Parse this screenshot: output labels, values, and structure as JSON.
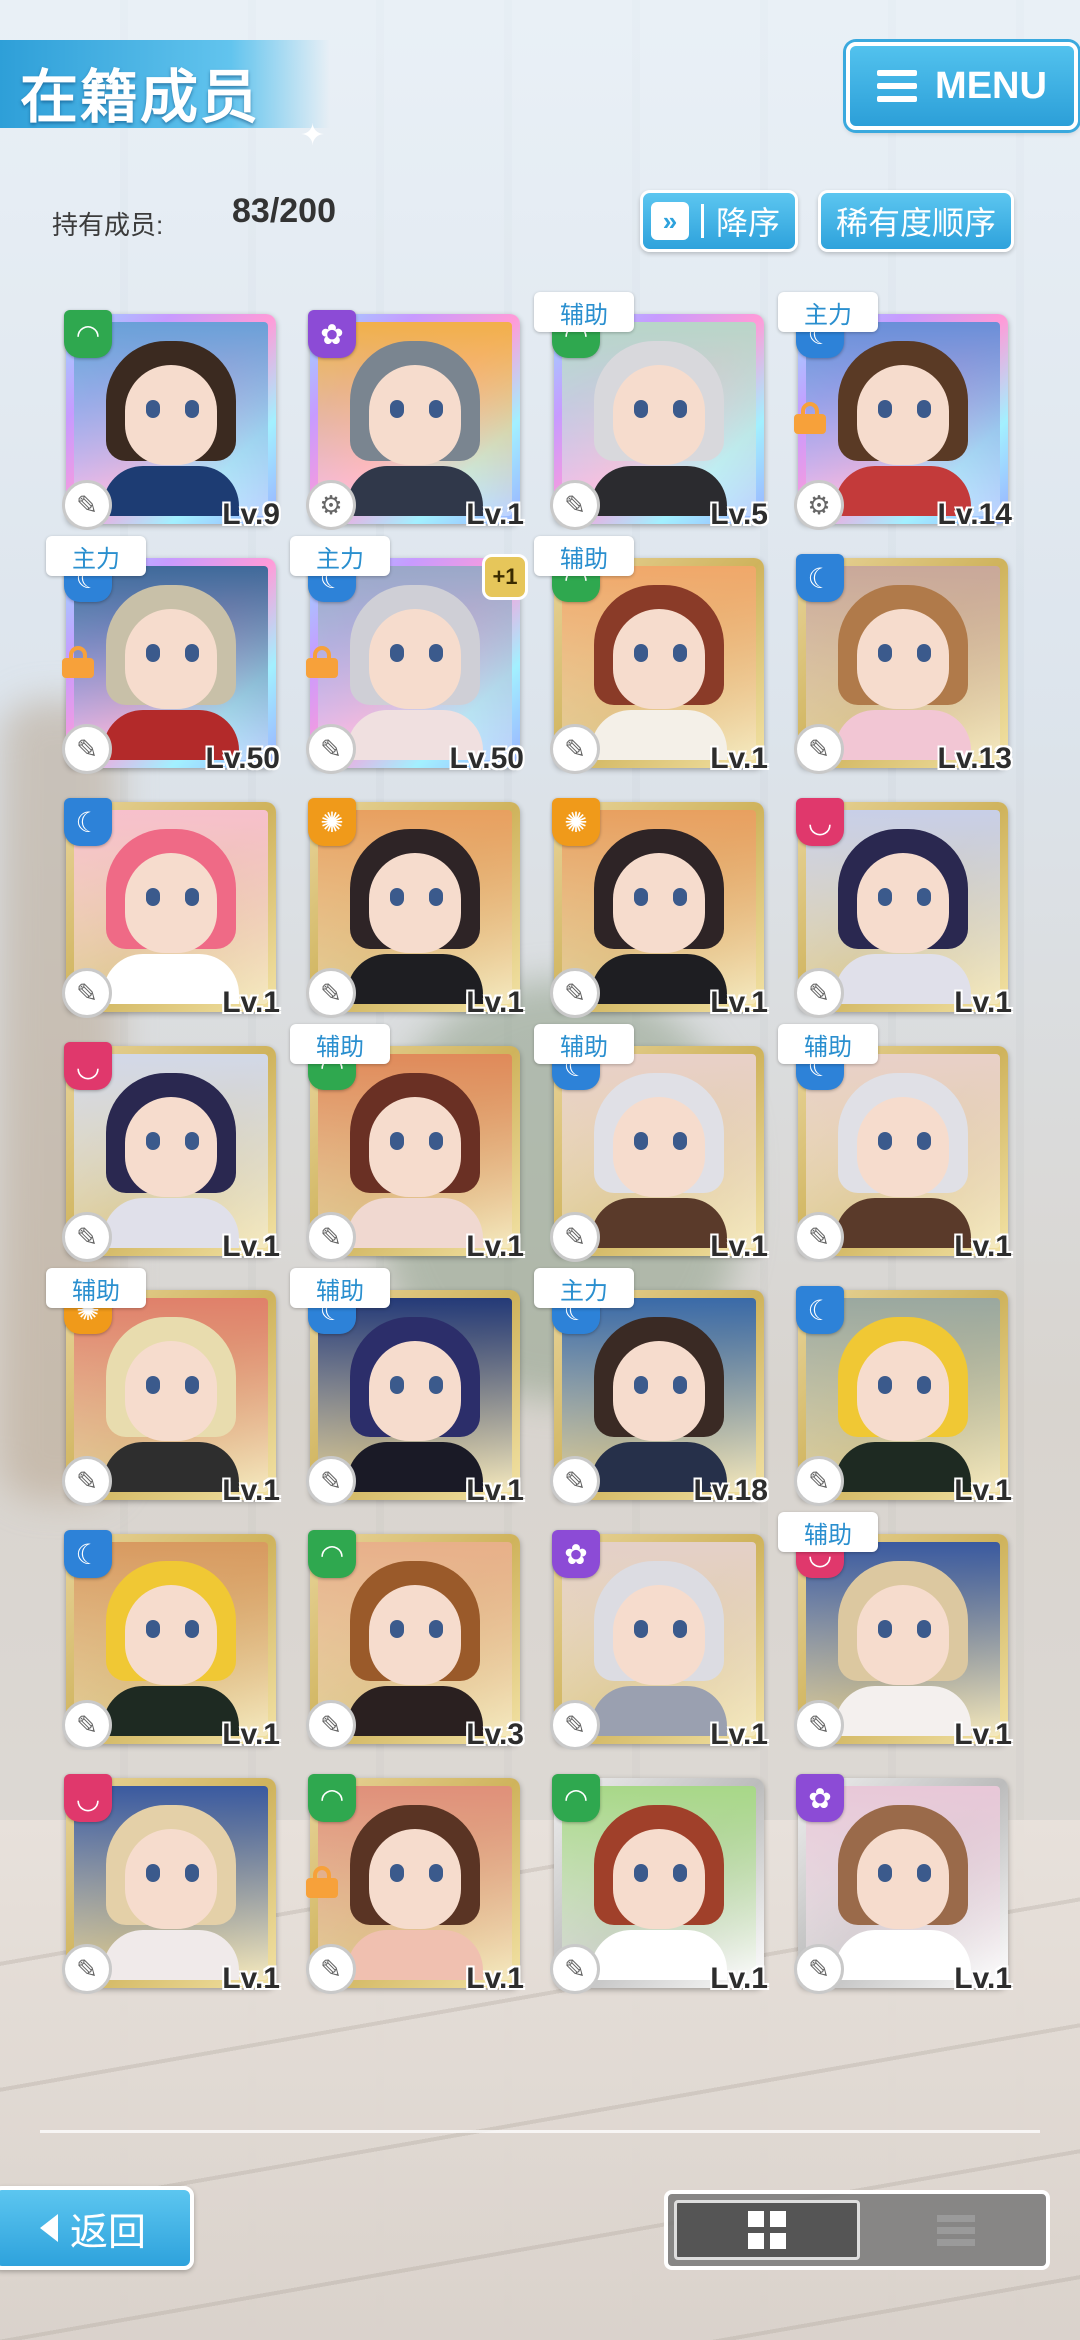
{
  "header": {
    "title": "在籍成员",
    "menu_label": "MENU"
  },
  "owned": {
    "label": "持有成员:",
    "value": "83/200"
  },
  "sort": {
    "order_label": "降序",
    "order_icon": "»",
    "rarity_label": "稀有度顺序"
  },
  "colors": {
    "accent": "#2ea2dc",
    "tag_text": "#2a8fcf",
    "lock": "#f7a13a"
  },
  "cards": [
    {
      "rarity": "rainbow",
      "attr": "green",
      "attr_icon": "◠",
      "role_icon": "✎",
      "level": "Lv.9",
      "tag": "",
      "lock": false,
      "plus": "",
      "hair": "#3b2a20",
      "bg": "#6aa0d8",
      "outfit": "#1d3c73"
    },
    {
      "rarity": "rainbow",
      "attr": "purple",
      "attr_icon": "✿",
      "role_icon": "⚙",
      "level": "Lv.1",
      "tag": "",
      "lock": false,
      "plus": "",
      "hair": "#7a8590",
      "bg": "#f2b04a",
      "outfit": "#30384a"
    },
    {
      "rarity": "rainbow",
      "attr": "green",
      "attr_icon": "◠",
      "role_icon": "✎",
      "level": "Lv.5",
      "tag": "辅助",
      "lock": false,
      "plus": "",
      "hair": "#d8d8dc",
      "bg": "#b8d6c8",
      "outfit": "#2b2b2f"
    },
    {
      "rarity": "rainbow",
      "attr": "blue",
      "attr_icon": "☾",
      "role_icon": "⚙",
      "level": "Lv.14",
      "tag": "主力",
      "lock": true,
      "plus": "",
      "hair": "#5a3a25",
      "bg": "#6a8fd8",
      "outfit": "#c33a3a"
    },
    {
      "rarity": "rainbow",
      "attr": "blue",
      "attr_icon": "☾",
      "role_icon": "✎",
      "level": "Lv.50",
      "tag": "主力",
      "lock": true,
      "plus": "",
      "hair": "#c8c0a8",
      "bg": "#3f6a9a",
      "outfit": "#b32a2a"
    },
    {
      "rarity": "rainbow",
      "attr": "blue",
      "attr_icon": "☾",
      "role_icon": "✎",
      "level": "Lv.50",
      "tag": "主力",
      "lock": true,
      "plus": "+1",
      "hair": "#cfcfd6",
      "bg": "#9aa8c8",
      "outfit": "#f0e0e0"
    },
    {
      "rarity": "gold",
      "attr": "green",
      "attr_icon": "◠",
      "role_icon": "✎",
      "level": "Lv.1",
      "tag": "辅助",
      "lock": false,
      "plus": "",
      "hair": "#8a3b28",
      "bg": "#f0a86a",
      "outfit": "#f4f0e8"
    },
    {
      "rarity": "gold",
      "attr": "blue",
      "attr_icon": "☾",
      "role_icon": "✎",
      "level": "Lv.13",
      "tag": "",
      "lock": false,
      "plus": "",
      "hair": "#b07a4a",
      "bg": "#c9a89a",
      "outfit": "#f2c6d4"
    },
    {
      "rarity": "gold",
      "attr": "blue",
      "attr_icon": "☾",
      "role_icon": "✎",
      "level": "Lv.1",
      "tag": "",
      "lock": false,
      "plus": "",
      "hair": "#ef6a86",
      "bg": "#f7c0cc",
      "outfit": "#ffffff"
    },
    {
      "rarity": "gold",
      "attr": "orange",
      "attr_icon": "✺",
      "role_icon": "✎",
      "level": "Lv.1",
      "tag": "",
      "lock": false,
      "plus": "",
      "hair": "#2e2426",
      "bg": "#e8a060",
      "outfit": "#1e1e22"
    },
    {
      "rarity": "gold",
      "attr": "orange",
      "attr_icon": "✺",
      "role_icon": "✎",
      "level": "Lv.1",
      "tag": "",
      "lock": false,
      "plus": "",
      "hair": "#2e2426",
      "bg": "#e8a060",
      "outfit": "#1e1e22"
    },
    {
      "rarity": "gold",
      "attr": "pink",
      "attr_icon": "◡",
      "role_icon": "✎",
      "level": "Lv.1",
      "tag": "",
      "lock": false,
      "plus": "",
      "hair": "#2a2850",
      "bg": "#c8cfe8",
      "outfit": "#e0e0ea"
    },
    {
      "rarity": "gold",
      "attr": "pink",
      "attr_icon": "◡",
      "role_icon": "✎",
      "level": "Lv.1",
      "tag": "",
      "lock": false,
      "plus": "",
      "hair": "#2a2850",
      "bg": "#d2d8e8",
      "outfit": "#e0e0ea"
    },
    {
      "rarity": "gold",
      "attr": "green",
      "attr_icon": "◠",
      "role_icon": "✎",
      "level": "Lv.1",
      "tag": "辅助",
      "lock": false,
      "plus": "",
      "hair": "#6a3024",
      "bg": "#e08a5a",
      "outfit": "#f0d8d0"
    },
    {
      "rarity": "gold",
      "attr": "blue",
      "attr_icon": "☾",
      "role_icon": "✎",
      "level": "Lv.1",
      "tag": "辅助",
      "lock": false,
      "plus": "",
      "hair": "#e0e0e6",
      "bg": "#e8d0c8",
      "outfit": "#5a3a2a"
    },
    {
      "rarity": "gold",
      "attr": "blue",
      "attr_icon": "☾",
      "role_icon": "✎",
      "level": "Lv.1",
      "tag": "辅助",
      "lock": false,
      "plus": "",
      "hair": "#e0e0e6",
      "bg": "#e8d0c8",
      "outfit": "#5a3a2a"
    },
    {
      "rarity": "gold",
      "attr": "orange",
      "attr_icon": "✺",
      "role_icon": "✎",
      "level": "Lv.1",
      "tag": "辅助",
      "lock": false,
      "plus": "",
      "hair": "#e8dcae",
      "bg": "#e0806a",
      "outfit": "#2e2e2e"
    },
    {
      "rarity": "gold",
      "attr": "blue",
      "attr_icon": "☾",
      "role_icon": "✎",
      "level": "Lv.1",
      "tag": "辅助",
      "lock": false,
      "plus": "",
      "hair": "#2c2e6a",
      "bg": "#243a78",
      "outfit": "#1a1a26"
    },
    {
      "rarity": "gold",
      "attr": "blue",
      "attr_icon": "☾",
      "role_icon": "✎",
      "level": "Lv.18",
      "tag": "主力",
      "lock": false,
      "plus": "",
      "hair": "#3a2a24",
      "bg": "#3a6aa8",
      "outfit": "#26304a"
    },
    {
      "rarity": "gold",
      "attr": "blue",
      "attr_icon": "☾",
      "role_icon": "✎",
      "level": "Lv.1",
      "tag": "",
      "lock": false,
      "plus": "",
      "hair": "#f0c834",
      "bg": "#9aa8a0",
      "outfit": "#1e2a22"
    },
    {
      "rarity": "gold",
      "attr": "blue",
      "attr_icon": "☾",
      "role_icon": "✎",
      "level": "Lv.1",
      "tag": "",
      "lock": false,
      "plus": "",
      "hair": "#f0c834",
      "bg": "#d89a60",
      "outfit": "#1e2a22"
    },
    {
      "rarity": "gold",
      "attr": "green",
      "attr_icon": "◠",
      "role_icon": "✎",
      "level": "Lv.3",
      "tag": "",
      "lock": false,
      "plus": "",
      "hair": "#9a5a2a",
      "bg": "#e8b08a",
      "outfit": "#2a2020"
    },
    {
      "rarity": "gold",
      "attr": "purple",
      "attr_icon": "✿",
      "role_icon": "✎",
      "level": "Lv.1",
      "tag": "",
      "lock": false,
      "plus": "",
      "hair": "#dcdce2",
      "bg": "#e4d0c8",
      "outfit": "#9aa0b0"
    },
    {
      "rarity": "gold",
      "attr": "pink",
      "attr_icon": "◡",
      "role_icon": "✎",
      "level": "Lv.1",
      "tag": "辅助",
      "lock": false,
      "plus": "",
      "hair": "#dcc8a0",
      "bg": "#3a5aa0",
      "outfit": "#f4f0ee"
    },
    {
      "rarity": "gold",
      "attr": "pink",
      "attr_icon": "◡",
      "role_icon": "✎",
      "level": "Lv.1",
      "tag": "",
      "lock": false,
      "plus": "",
      "hair": "#e4d0a8",
      "bg": "#3a5aa0",
      "outfit": "#f0eaea"
    },
    {
      "rarity": "gold",
      "attr": "green",
      "attr_icon": "◠",
      "role_icon": "✎",
      "level": "Lv.1",
      "tag": "",
      "lock": true,
      "plus": "",
      "hair": "#5a3424",
      "bg": "#e0907a",
      "outfit": "#f0c0b0"
    },
    {
      "rarity": "silver",
      "attr": "green",
      "attr_icon": "◠",
      "role_icon": "✎",
      "level": "Lv.1",
      "tag": "",
      "lock": false,
      "plus": "",
      "hair": "#a0402a",
      "bg": "#a8d888",
      "outfit": "#ffffff"
    },
    {
      "rarity": "silver",
      "attr": "purple",
      "attr_icon": "✿",
      "role_icon": "✎",
      "level": "Lv.1",
      "tag": "",
      "lock": false,
      "plus": "",
      "hair": "#9a6a4a",
      "bg": "#e8c8d8",
      "outfit": "#ffffff"
    }
  ],
  "footer": {
    "back_label": "返回"
  }
}
